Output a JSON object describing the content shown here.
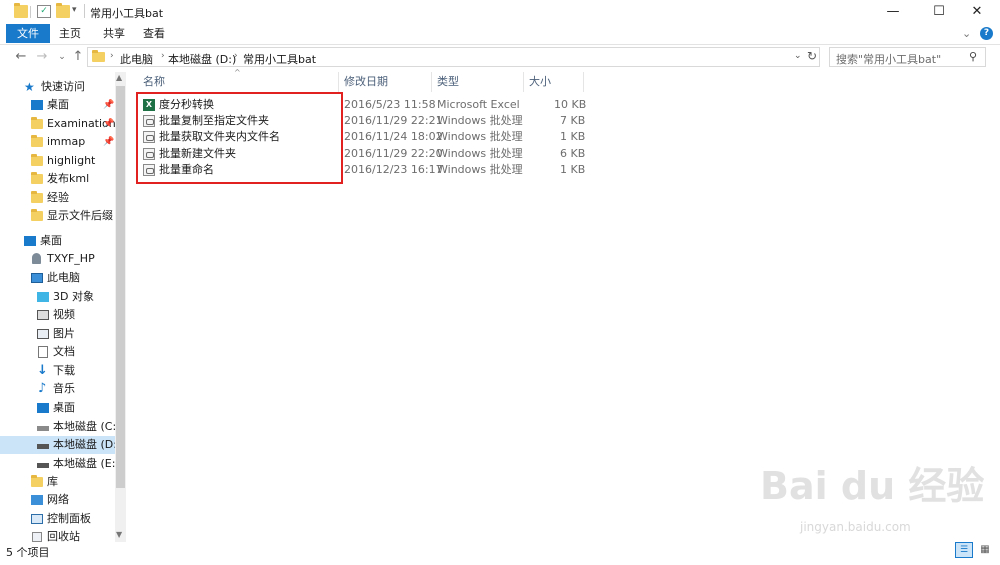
{
  "window": {
    "title": "常用小工具bat",
    "minimize": "—",
    "maximize": "☐",
    "close": "✕"
  },
  "ribbon": {
    "tabs": [
      "文件",
      "主页",
      "共享",
      "查看"
    ],
    "help": "?",
    "expand": "⌄"
  },
  "address": {
    "crumbs": [
      "此电脑",
      "本地磁盘 (D:)",
      "常用小工具bat"
    ],
    "search_placeholder": "搜索\"常用小工具bat\""
  },
  "nav": {
    "quick_access": "快速访问",
    "quick_items": [
      "桌面",
      "Examination",
      "immap",
      "highlight",
      "发布kml",
      "经验",
      "显示文件后缀"
    ],
    "desktop": "桌面",
    "user": "TXYF_HP",
    "this_pc": "此电脑",
    "pc_items": [
      "3D 对象",
      "视频",
      "图片",
      "文档",
      "下载",
      "音乐",
      "桌面",
      "本地磁盘 (C:)",
      "本地磁盘 (D:)",
      "本地磁盘 (E:)"
    ],
    "library": "库",
    "network": "网络",
    "control_panel": "控制面板",
    "recycle": "回收站"
  },
  "columns": {
    "name": "名称",
    "date": "修改日期",
    "type": "类型",
    "size": "大小"
  },
  "files": [
    {
      "name": "度分秒转换",
      "date": "2016/5/23 11:58",
      "type": "Microsoft Excel",
      "size": "10 KB",
      "icon": "excel-file-icon"
    },
    {
      "name": "批量复制至指定文件夹",
      "date": "2016/11/29 22:21",
      "type": "Windows 批处理",
      "size": "7 KB",
      "icon": "batch-file-icon"
    },
    {
      "name": "批量获取文件夹内文件名",
      "date": "2016/11/24 18:02",
      "type": "Windows 批处理",
      "size": "1 KB",
      "icon": "batch-file-icon"
    },
    {
      "name": "批量新建文件夹",
      "date": "2016/11/29 22:20",
      "type": "Windows 批处理",
      "size": "6 KB",
      "icon": "batch-file-icon"
    },
    {
      "name": "批量重命名",
      "date": "2016/12/23 16:17",
      "type": "Windows 批处理",
      "size": "1 KB",
      "icon": "batch-file-icon"
    }
  ],
  "status": {
    "count": "5 个项目"
  },
  "watermark": {
    "main": "Bai du 经验",
    "sub": "jingyan.baidu.com"
  },
  "colors": {
    "accent": "#1979ca",
    "highlight_box": "#e12020",
    "selection": "#cce4f7"
  }
}
